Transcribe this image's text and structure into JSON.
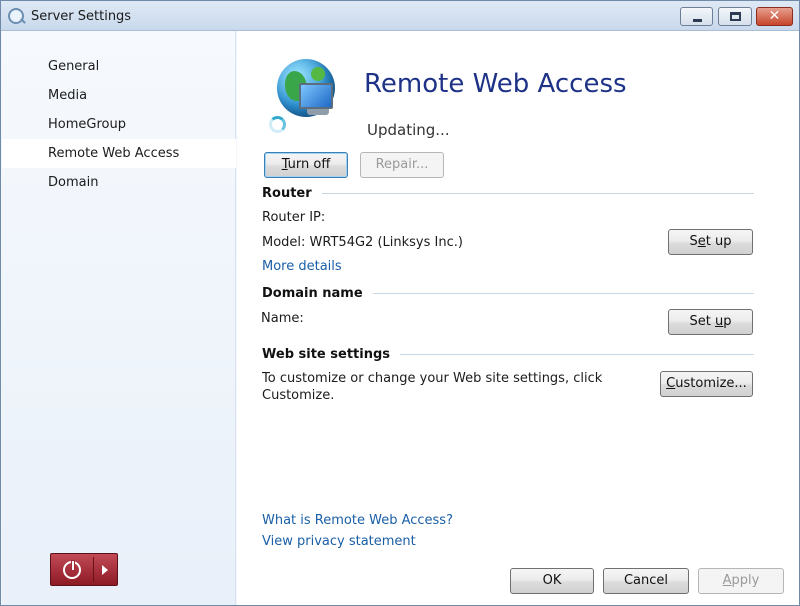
{
  "window": {
    "title": "Server Settings"
  },
  "sidebar": {
    "items": [
      {
        "label": "General"
      },
      {
        "label": "Media"
      },
      {
        "label": "HomeGroup"
      },
      {
        "label": "Remote Web Access",
        "active": true
      },
      {
        "label": "Domain"
      }
    ]
  },
  "header": {
    "title": "Remote Web Access",
    "status": "Updating..."
  },
  "actions": {
    "turn_off": {
      "pre": "",
      "key": "T",
      "post": "urn off"
    },
    "repair": "Repair..."
  },
  "router": {
    "heading": "Router",
    "ip_label": "Router IP:",
    "model_label": "Model: WRT54G2 (Linksys Inc.)",
    "setup": {
      "pre": "S",
      "key": "e",
      "post": "t up"
    },
    "more_details": "More details"
  },
  "domain": {
    "heading": "Domain name",
    "name_label": "Name:",
    "setup": {
      "pre": "Set ",
      "key": "u",
      "post": "p"
    }
  },
  "website": {
    "heading": "Web site settings",
    "desc_line1": "To customize or change your Web site settings, click",
    "desc_line2": "Customize.",
    "customize": {
      "pre": "",
      "key": "C",
      "post": "ustomize..."
    }
  },
  "links": {
    "what_is": "What is Remote Web Access?",
    "privacy": "View privacy statement"
  },
  "footer": {
    "ok": "OK",
    "cancel": "Cancel",
    "apply": {
      "pre": "",
      "key": "A",
      "post": "pply"
    }
  },
  "colors": {
    "title_blue": "#1e3287",
    "link_blue": "#1a5fa6",
    "power_red": "#a52a35"
  },
  "icons": {
    "app": "server-settings-icon",
    "feature": "globe-monitor-icon",
    "status": "spinner-icon",
    "power": "power-icon"
  }
}
